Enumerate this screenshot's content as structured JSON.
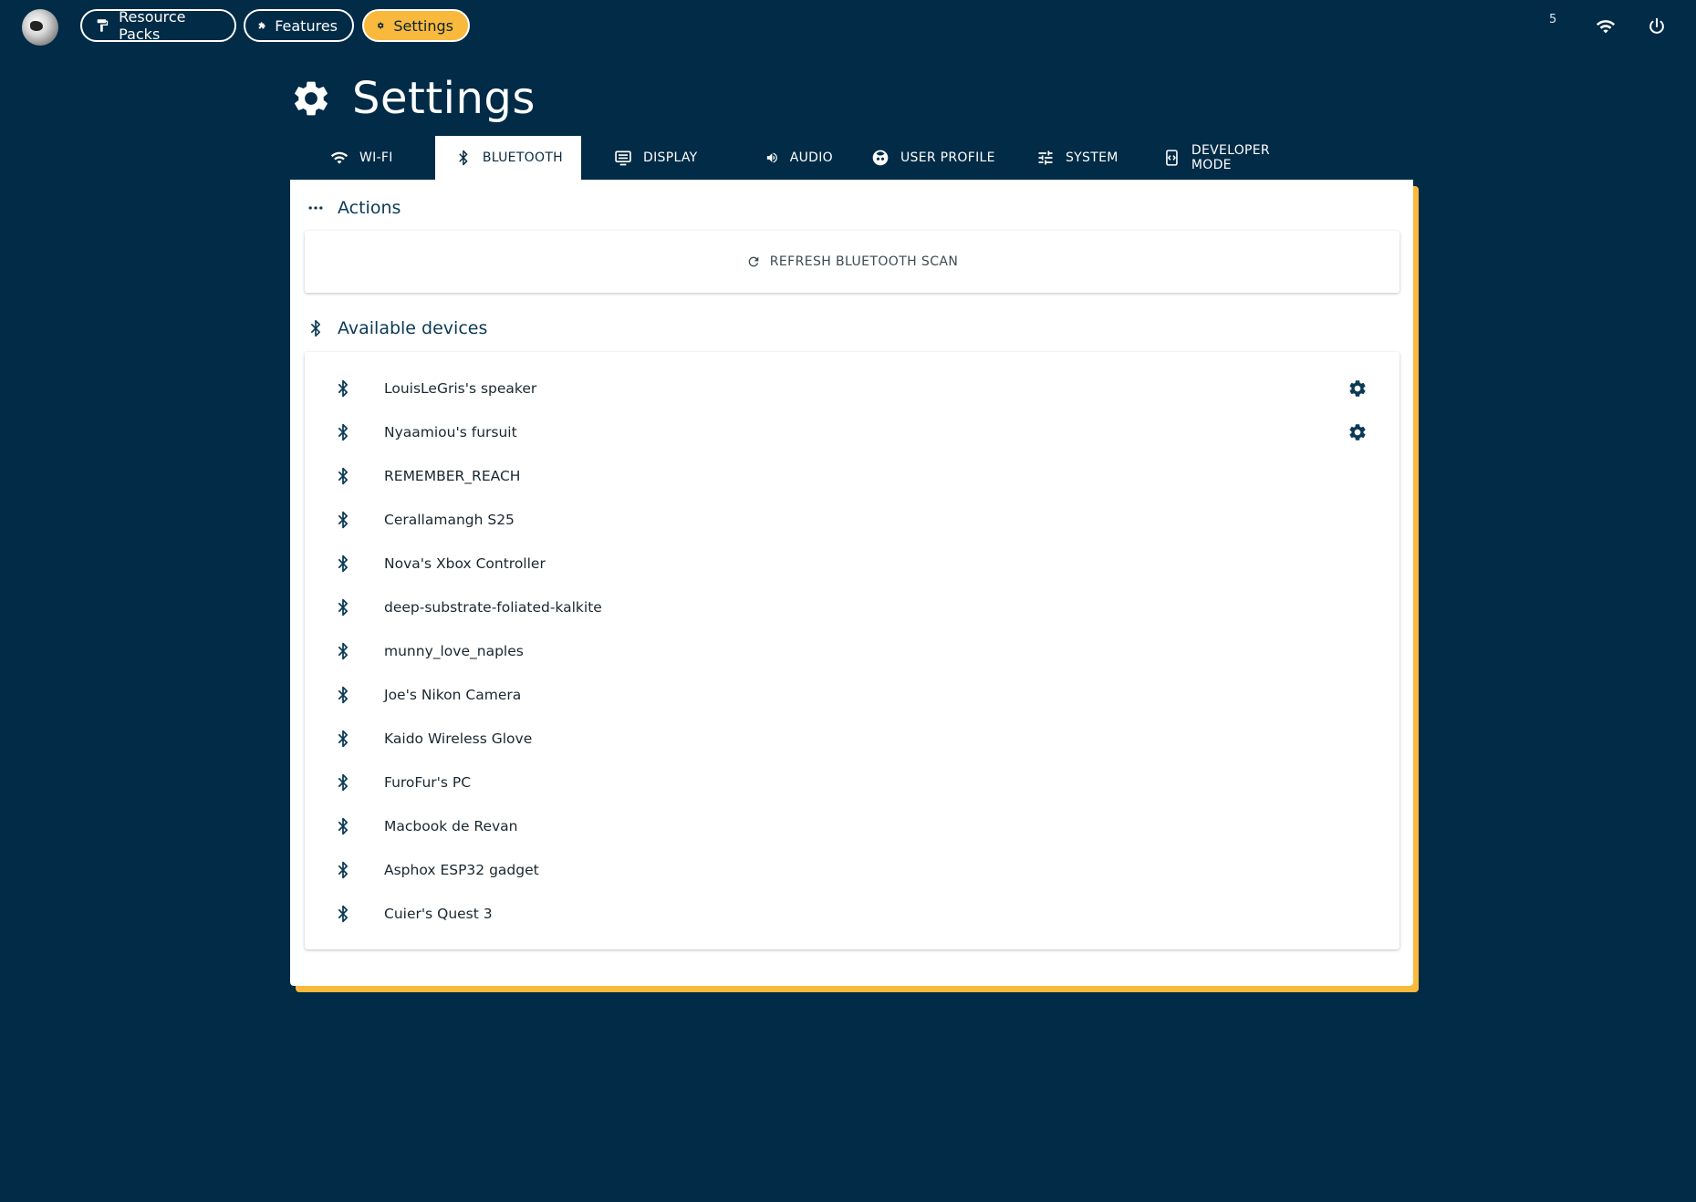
{
  "nav": {
    "items": [
      {
        "label": "Resource Packs",
        "icon": "paint-roller-icon",
        "active": false
      },
      {
        "label": "Features",
        "icon": "puzzle-icon",
        "active": false
      },
      {
        "label": "Settings",
        "icon": "gear-icon",
        "active": true
      }
    ],
    "status": {
      "badge": "5"
    }
  },
  "page": {
    "title": "Settings"
  },
  "tabs": [
    {
      "label": "Wi-Fi",
      "icon": "wifi-icon"
    },
    {
      "label": "Bluetooth",
      "icon": "bluetooth-icon"
    },
    {
      "label": "Display",
      "icon": "display-icon"
    },
    {
      "label": "Audio",
      "icon": "speaker-icon"
    },
    {
      "label": "User Profile",
      "icon": "face-icon"
    },
    {
      "label": "System",
      "icon": "sliders-icon"
    },
    {
      "label": "Developer Mode",
      "icon": "developer-icon"
    }
  ],
  "actions": {
    "title": "Actions",
    "refresh_label": "Refresh Bluetooth scan"
  },
  "devices": {
    "title": "Available devices",
    "items": [
      {
        "name": "LouisLeGris's speaker",
        "has_settings": true
      },
      {
        "name": "Nyaamiou's fursuit",
        "has_settings": true
      },
      {
        "name": "REMEMBER_REACH",
        "has_settings": false
      },
      {
        "name": "Cerallamangh S25",
        "has_settings": false
      },
      {
        "name": "Nova's Xbox Controller",
        "has_settings": false
      },
      {
        "name": "deep-substrate-foliated-kalkite",
        "has_settings": false
      },
      {
        "name": "munny_love_naples",
        "has_settings": false
      },
      {
        "name": "Joe's Nikon Camera",
        "has_settings": false
      },
      {
        "name": "Kaido Wireless Glove",
        "has_settings": false
      },
      {
        "name": "FuroFur's PC",
        "has_settings": false
      },
      {
        "name": "Macbook de Revan",
        "has_settings": false
      },
      {
        "name": "Asphox ESP32 gadget",
        "has_settings": false
      },
      {
        "name": "Cuier's Quest 3",
        "has_settings": false
      }
    ]
  },
  "colors": {
    "background": "#012b46",
    "accent": "#f8b93d",
    "card": "#ffffff",
    "icon_dark": "#0b3a56"
  }
}
